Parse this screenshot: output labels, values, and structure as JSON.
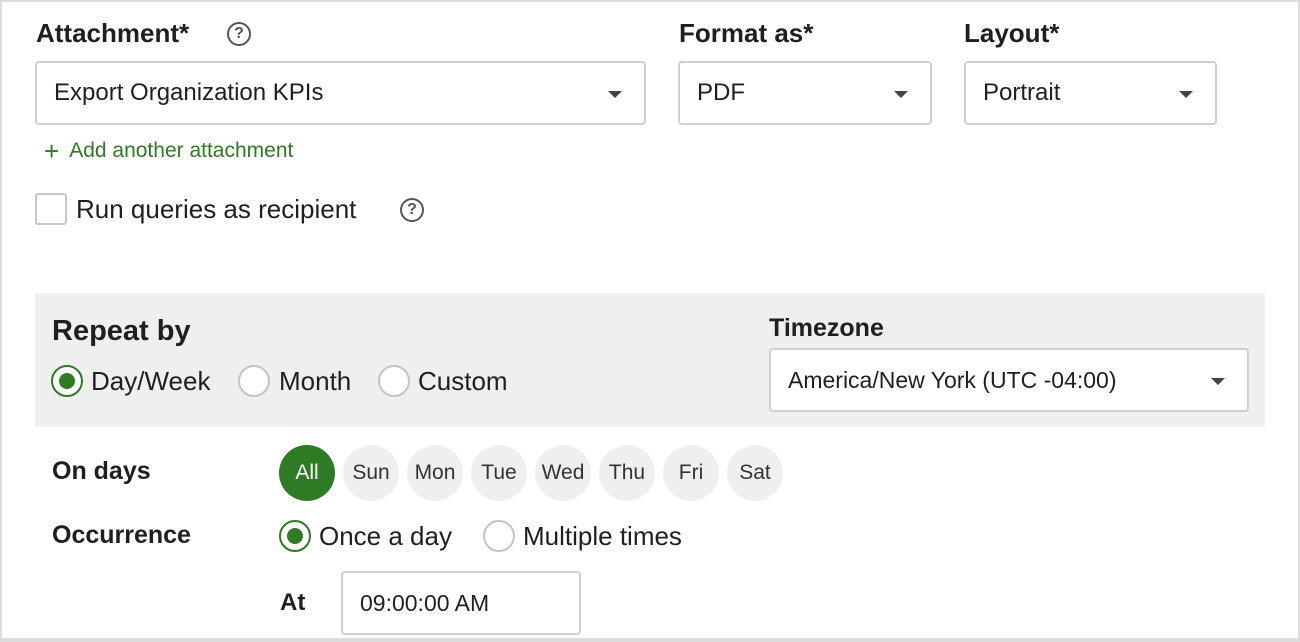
{
  "attachment": {
    "label": "Attachment*",
    "help": "?",
    "value": "Export Organization KPIs",
    "add_link": "Add another attachment",
    "add_icon": "+"
  },
  "format": {
    "label": "Format as*",
    "value": "PDF"
  },
  "layout": {
    "label": "Layout*",
    "value": "Portrait"
  },
  "run_queries": {
    "label": "Run queries as recipient",
    "help": "?",
    "checked": false
  },
  "repeat": {
    "title": "Repeat by",
    "options": [
      "Day/Week",
      "Month",
      "Custom"
    ],
    "selected": "Day/Week"
  },
  "timezone": {
    "label": "Timezone",
    "value": "America/New York (UTC -04:00)"
  },
  "on_days": {
    "label": "On days",
    "days": [
      "All",
      "Sun",
      "Mon",
      "Tue",
      "Wed",
      "Thu",
      "Fri",
      "Sat"
    ],
    "selected": "All"
  },
  "occurrence": {
    "label": "Occurrence",
    "options": [
      "Once a day",
      "Multiple times"
    ],
    "selected": "Once a day"
  },
  "at": {
    "label": "At",
    "value": "09:00:00 AM"
  },
  "colors": {
    "accent": "#2f7a25",
    "band": "#efefef",
    "border": "#cfcfcf"
  }
}
